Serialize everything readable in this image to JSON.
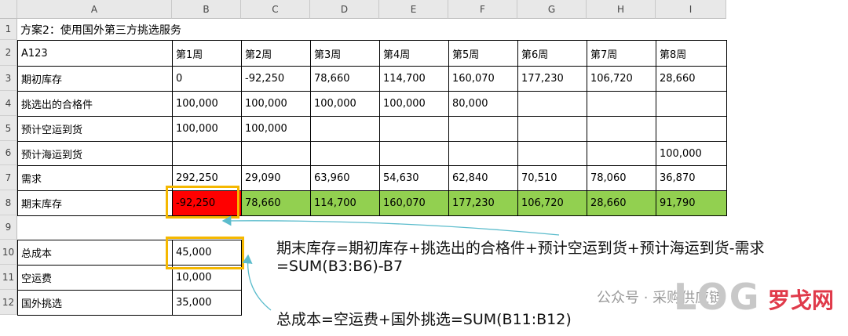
{
  "columns": [
    "A",
    "B",
    "C",
    "D",
    "E",
    "F",
    "G",
    "H",
    "I"
  ],
  "rows": [
    "1",
    "2",
    "3",
    "4",
    "5",
    "6",
    "7",
    "8",
    "9",
    "10",
    "11",
    "12"
  ],
  "title": "方案2：使用国外第三方挑选服务",
  "table": {
    "header": [
      "A123",
      "第1周",
      "第2周",
      "第3周",
      "第4周",
      "第5周",
      "第6周",
      "第7周",
      "第8周"
    ],
    "rows": [
      {
        "label": "期初库存",
        "values": [
          "0",
          "-92,250",
          "78,660",
          "114,700",
          "160,070",
          "177,230",
          "106,720",
          "28,660"
        ]
      },
      {
        "label": "挑选出的合格件",
        "values": [
          "100,000",
          "100,000",
          "100,000",
          "100,000",
          "80,000",
          "",
          "",
          ""
        ]
      },
      {
        "label": "预计空运到货",
        "values": [
          "100,000",
          "100,000",
          "",
          "",
          "",
          "",
          "",
          ""
        ]
      },
      {
        "label": "预计海运到货",
        "values": [
          "",
          "",
          "",
          "",
          "",
          "",
          "",
          "100,000"
        ]
      },
      {
        "label": "需求",
        "values": [
          "292,250",
          "29,090",
          "63,960",
          "54,630",
          "62,840",
          "70,510",
          "78,060",
          "36,870"
        ]
      },
      {
        "label": "期末库存",
        "values": [
          "-92,250",
          "78,660",
          "114,700",
          "160,070",
          "177,230",
          "106,720",
          "28,660",
          "91,790"
        ]
      }
    ]
  },
  "cost": [
    {
      "label": "总成本",
      "value": "45,000"
    },
    {
      "label": "空运费",
      "value": "10,000"
    },
    {
      "label": "国外挑选",
      "value": "35,000"
    }
  ],
  "annotations": {
    "formula1_line1": "期末库存=期初库存+挑选出的合格件+预计空运到货+预计海运到货-需求",
    "formula1_line2": "=SUM(B3:B6)-B7",
    "formula2": "总成本=空运费+国外挑选=SUM(B11:B12)"
  },
  "watermark": {
    "account": "公众号 · 采购供应链",
    "logo_text": "LOG",
    "logo_cn": "罗戈网"
  },
  "colors": {
    "negative_fill": "#ff0000",
    "positive_fill": "#92d050",
    "highlight_box": "#f5b800",
    "arrow": "#5bbccc"
  }
}
